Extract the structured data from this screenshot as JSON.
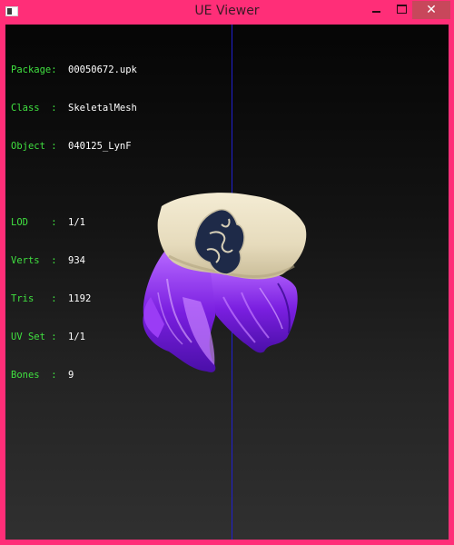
{
  "window": {
    "title": "UE Viewer",
    "controls": {
      "minimize": "minimize-icon",
      "maximize": "maximize-icon",
      "close": "✕"
    }
  },
  "info": {
    "package": {
      "label": "Package:",
      "value": "00050672.upk"
    },
    "class": {
      "label": "Class  :",
      "value": "SkeletalMesh"
    },
    "object": {
      "label": "Object :",
      "value": "040125_LynF"
    },
    "lod": {
      "label": "LOD    :",
      "value": "1/1"
    },
    "verts": {
      "label": "Verts  :",
      "value": "934"
    },
    "tris": {
      "label": "Tris   :",
      "value": "1192"
    },
    "uvset": {
      "label": "UV Set :",
      "value": "1/1"
    },
    "bones": {
      "label": "Bones  :",
      "value": "9"
    }
  },
  "colors": {
    "frame": "#ff2e78",
    "label_green": "#40e040",
    "axis_blue": "#1f1fd0",
    "hat": "#ece2c4",
    "hair": "#8a2ee8",
    "emblem": "#1e2a48"
  }
}
